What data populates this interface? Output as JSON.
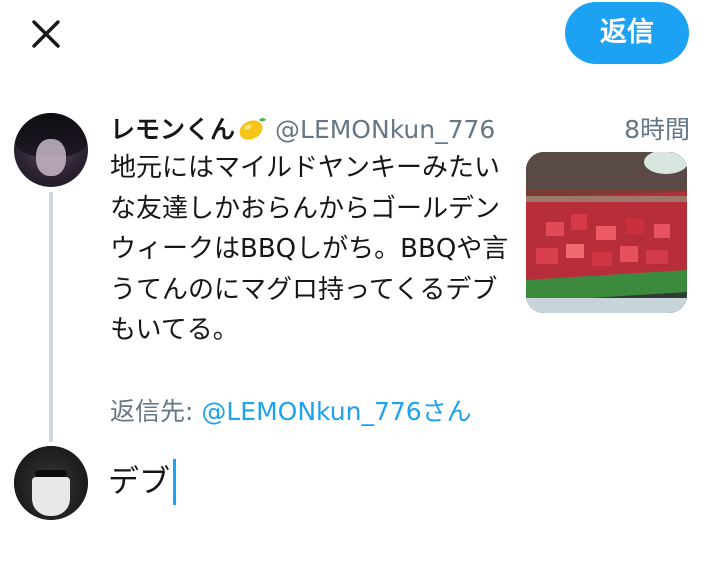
{
  "toolbar": {
    "close_icon": "close-icon",
    "reply_label": "返信"
  },
  "original_tweet": {
    "display_name": "レモンくん",
    "name_emoji_icon": "lemon-icon",
    "handle": "@LEMONkun_776",
    "time": "8時間",
    "text": "地元にはマイルドヤンキーみたいな友達しかおらんからゴールデンウィークはBBQしがち。BBQや言うてんのにマグロ持ってくるデブもいてる。",
    "media_description_icon": "photo"
  },
  "reply_context": {
    "prefix": "返信先: ",
    "target": "@LEMONkun_776さん"
  },
  "compose": {
    "text": "デブ"
  },
  "colors": {
    "accent": "#1da1f2",
    "secondary_text": "#657786",
    "primary_text": "#14171a",
    "thread_line": "#cfd9de"
  }
}
